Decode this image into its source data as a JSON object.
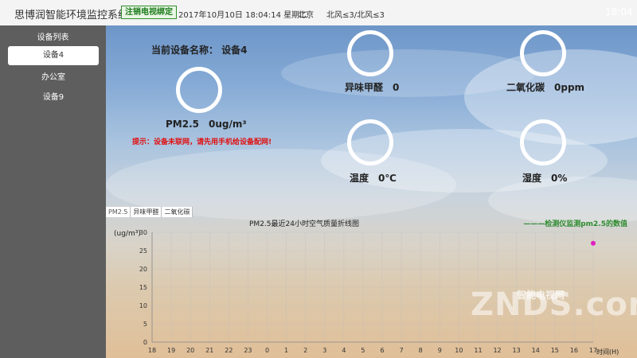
{
  "header": {
    "app_title": "思博润智能环境监控系统",
    "logout_label": "注销电视绑定",
    "datetime": "2017年10月10日 18:04:14 星期二",
    "city": "北京",
    "wind": "北风≤3/北风≤3",
    "clock": "18:04"
  },
  "sidebar": {
    "title": "设备列表",
    "items": [
      {
        "label": "设备4",
        "active": true
      },
      {
        "label": "办公室",
        "active": false
      },
      {
        "label": "设备9",
        "active": false
      }
    ]
  },
  "main": {
    "device_name": "当前设备名称： 设备4",
    "hint": "提示：设备未联网，请先用手机给设备配网!",
    "gauges": {
      "pm25": "PM2.5　0ug/m³",
      "formaldehyde": "异味甲醛　0",
      "co2": "二氧化碳　0ppm",
      "temperature": "温度　0℃",
      "humidity": "湿度　0%"
    }
  },
  "chart_tabs": [
    "PM2.5",
    "异味甲醛",
    "二氧化碳"
  ],
  "chart_data": {
    "type": "line",
    "title": "PM2.5最近24小时空气质量折线图",
    "ylabel": "(ug/m³)",
    "xlabel": "时间(H)",
    "legend": "———检测仪监测pm2.5的数值",
    "legend_position": "top-right",
    "ylim": [
      0,
      30
    ],
    "yticks": [
      0,
      5,
      10,
      15,
      20,
      25,
      30
    ],
    "categories": [
      "19",
      "20",
      "21",
      "22",
      "23",
      "0",
      "1",
      "2",
      "3",
      "4",
      "5",
      "6",
      "7",
      "8",
      "9",
      "10",
      "11",
      "12",
      "13",
      "14",
      "15",
      "16",
      "17"
    ],
    "xtick_labels": [
      "18",
      "19",
      "20",
      "21",
      "22",
      "23",
      "0",
      "1",
      "2",
      "3",
      "4",
      "5",
      "6",
      "7",
      "8",
      "9",
      "10",
      "11",
      "12",
      "13",
      "14",
      "15",
      "16",
      "17"
    ],
    "series": [
      {
        "name": "检测仪监测pm2.5的数值",
        "color": "#e020c0",
        "points": [
          {
            "x": "17",
            "y": 27
          }
        ]
      }
    ],
    "grid": true
  },
  "watermark": "ZNDS.com",
  "watermark_sub": "智能电视网"
}
